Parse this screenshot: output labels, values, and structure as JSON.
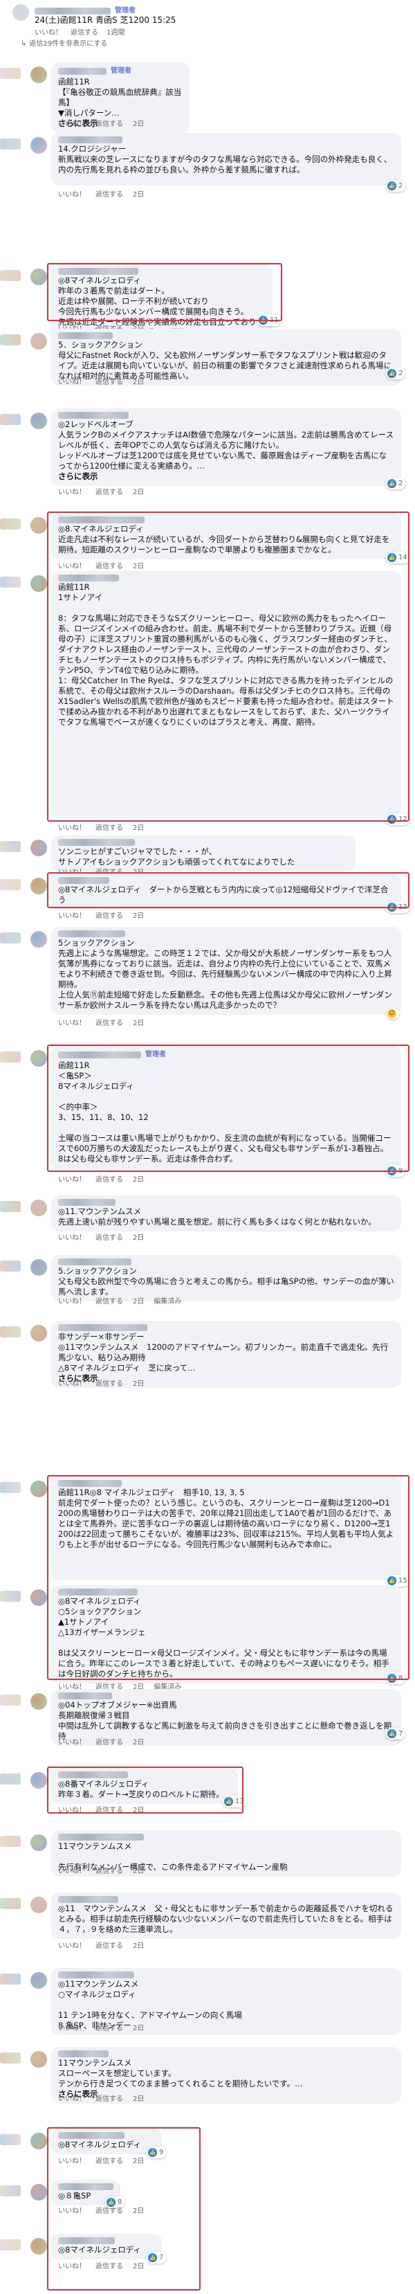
{
  "header": {
    "admin_badge": "管理者",
    "post_title": "24(土)函館11R 青函S 芝1200 15:25",
    "meta": [
      "いいね！",
      "返信する",
      "1週間"
    ],
    "hidden_replies": "返信29件を非表示にする"
  },
  "colors": {
    "highlight": "#e0313f",
    "bubble": "#f0f2f5",
    "reaction": "#0a6ee0",
    "meta": "#65676b"
  },
  "comments": [
    {
      "id": "c1",
      "admin": true,
      "text": "函館11R\n【『亀谷敬正の競馬血統辞典』該当馬】\n▼消しパターン…",
      "more": "さらに表示",
      "meta": [
        "いいね！",
        "返信する",
        "2日"
      ],
      "reaction": null
    },
    {
      "id": "c2",
      "admin": false,
      "text": "14.クロジシジャー\n新馬戦以来の芝レースになりますが今のタフな馬場なら対応できる。今回の外枠発走も良く、内の先行馬を見れる枠の並びも良い。外枠から差す競馬に徹すれば。",
      "more": "",
      "meta": [
        "いいね！",
        "返信する",
        "2日"
      ],
      "reaction": "2"
    },
    {
      "id": "c3",
      "admin": false,
      "text": "◎8マイネルジェロディ\n昨年の３着馬で前走はダート。\n近走は枠や展開、ローテ不利が続いており\n今回先行馬も少ないメンバー構成で展開も向きそう。\n先週は近走ダート経験馬や実績馬の好走も目立っており\nロベルト系も好調。巻き返しに期待。",
      "more": "",
      "meta": [
        "いいね！",
        "返信する",
        "2日"
      ],
      "reaction": "11"
    },
    {
      "id": "c4",
      "admin": false,
      "text": "5．ショックアクション\n母父にFastnet Rockが入り、父も欧州ノーザンダンサー系でタフなスプリント戦は歓迎のタイプ。近走は展開も向いていないが、前日の稍重の影響でタフさと減速耐性求められる馬場になれば相対的に素質ある可能性高い。",
      "more": "",
      "meta": [
        "いいね！",
        "返信する",
        "2日"
      ],
      "reaction": "2"
    },
    {
      "id": "c5",
      "admin": false,
      "text": "◎2レッドベルオーブ\n人気ランクBのメイクアスナッチはAI数値で危険なパターンに該当。2走前は勝馬含めてレースレベルが低く、去年OPでこの人気ならば消える方に賭けたい。\nレッドベルオーブは芝1200では底を見せていない馬で、藤原厩舎はディープ産駒を古馬になってから1200仕様に変える実績あり。…",
      "more": "さらに表示",
      "meta": [
        "いいね！",
        "返信する",
        "2日"
      ],
      "reaction": "2"
    },
    {
      "id": "c6",
      "admin": false,
      "text": "◎8.マイネルジェロディ\n近走凡走は不利なレースが続いているが、今回ダートから芝替わり&展開も向くと見て好走を期待。短距離のスクリーンヒーロー産駒なので単勝よりも複勝圏までかなと。",
      "more": "",
      "meta": [
        "いいね！",
        "返信する",
        "2日"
      ],
      "reaction": "14"
    },
    {
      "id": "c7",
      "admin": false,
      "text": "函館11R\n1サトノアイ\n\n8：タフな馬場に対応できそうなSズクリーンヒーロー、母父に欧州の馬力をもったヘイロー系、ロージズインメイの組み合わせ。前走、馬場不利でダートから芝替わりプラス。近親（母母の子）に洋芝スプリント重賞の勝利馬がいるのも心強く、グラスワンダー経由のダンチヒ、ダイナアクトレス経由のノーザンテースト、三代母のノーザンテーストの血が合わさり、ダンチヒもノーザンテーストのクロス持ちもポジティブ。内枠に先行馬がいないメンバー構成で、テンP5O、テンT4位で粘り込みに期待。\n1：母父Catcher In The Ryeは、タフな芝スプリントに対応できる馬力を持ったデインヒルの系統で、その母父は欧州ナスルーラのDarshaan。母系は父ダンチヒのクロス持ち。三代母のX1Sadler's Wellsの肌馬で欧州色が強めもスピード要素も持った組み合わせ。前走はスタートで揉め込み抜かれる不利があり出遅れてまともなレースをしておらず、また、父ハーツクライでタフな馬場でベースが速くなりにくいのはプラスと考え、再度、期待。",
      "more": "",
      "meta": [
        "いいね！",
        "返信する",
        "2日"
      ],
      "reaction": "12"
    },
    {
      "id": "c8",
      "admin": false,
      "text": "ソンニッヒがすごいジャマでした・・・が、\nサトノアイもショックアクションも頑張ってくれてなによりでした",
      "more": "",
      "meta": [
        "いいね！",
        "返信する",
        "2日"
      ],
      "reaction": null
    },
    {
      "id": "c9",
      "admin": false,
      "text": "◎8マイネルジェロディ　ダートから芝戦ともう内内に戻って◎12短縮母父ドヴァイで洋芝合う",
      "more": "",
      "meta": [
        "いいね！",
        "返信する",
        "2日"
      ],
      "reaction": "12"
    },
    {
      "id": "c10",
      "admin": false,
      "text": "5ショックアクション\n先週上にような馬場想定。この時芝１２では、父か母父が大系統ノーザンダンサー系をもつ人気薄が馬券になっておりに該当。近走は、自分より内枠の先行上位にいていることで、双馬メモより不利続きで巻き返せ到。今回は、先行経験馬少ないメンバー構成の中で内枠に入り上昇期待。\n上位人気⑪前走短縮で好走した反動懸念。その他も先週上位馬は父か母父に欧州ノーザンダンサー系か欧州ナスルーラ系を持たない馬は凡走多かったので？",
      "more": "",
      "meta": [
        "いいね！",
        "返信する",
        "2日"
      ],
      "reaction": "laugh"
    },
    {
      "id": "c11",
      "admin": true,
      "text": "函館11R\n＜亀SP＞\n8マイネルジェロディ\n\n＜的中率＞\n3、15、11、8、10、12\n\n土曜の当コースは重い馬場で上がりもかかり、反主流の血統が有利になっている。当開催コースで600万勝ちの大波乱だったレースも上がり遅く、父も母父も非サンデー系が1-3着独占。\n8は父も母父も非サンデー系。近走は条件合わず。",
      "more": "",
      "meta": [
        "いいね！",
        "返信する",
        "2日"
      ],
      "reaction": "8"
    },
    {
      "id": "c12",
      "admin": false,
      "text": "◎11.マウンテンムスメ\n先週上速い前が残りやすい馬場と風を想定。前に行く馬も多くはなく何とか粘れないか。",
      "more": "",
      "meta": [
        "いいね！",
        "返信する",
        "2日"
      ],
      "reaction": null
    },
    {
      "id": "c13",
      "admin": false,
      "text": "5.ショックアクション\n父も母父も欧州型で今の馬場に合うと考えこの馬から。相手は亀SPの他、サンデーの血が薄い馬へ流します。",
      "more": "",
      "meta": [
        "いいね！",
        "返信する",
        "2日",
        "編集済み"
      ],
      "reaction": null
    },
    {
      "id": "c14",
      "admin": false,
      "text": "非サンデー×非サンデー\n◎11マウンテンムスメ　1200のアドマイヤムーン。初ブリンカー。前走直千で逃走化。先行馬少ない、粘り込み期待\n△8マイネルジェロディ　芝に戻って…",
      "more": "さらに表示",
      "meta": [
        "いいね！",
        "返信する",
        "2日"
      ],
      "reaction": null
    },
    {
      "id": "c15",
      "admin": false,
      "text": "函館11R◎8 マイネルジェロディ　相手10, 13, 3, 5\n前走何でダート使ったの？という感じ。というのも、スクリーンヒーロー産駒は芝1200→D1200の馬場替わりローテは大の苦手で、20年以降21回出走して1A0で着が1回のるだけで、あとは全て馬券外。逆に苦手なローテの裏返しは期待値の高いローテになり易く、D1200→芝1200は22回走って勝ちこそないが、複勝率は23%、回収率は215%。平均人気着も平均人気よりも上と手が出せるローテになる。今回先行馬少ない展開利も込みで本命に。",
      "more": "",
      "meta": [
        "いいね！",
        "返信する",
        "2日"
      ],
      "reaction": "15"
    },
    {
      "id": "c16",
      "admin": false,
      "text": "◎8マイネルジェロディ\n○5ショックアクション\n▲1サトノアイ\n△13ガイザーメランジェ\n\n8は父スクリーンヒーロー×母父ロージズインメイ。父・母父ともに非サンデー系は今の馬場に合う。昨年にこのレースで３着と好走していて、その時よりもペース遅いになりそう。相手は今日好調のダンチヒ持ちから。",
      "more": "",
      "meta": [
        "いいね！",
        "返信する",
        "2日",
        "編集済み"
      ],
      "reaction": "8"
    },
    {
      "id": "c17",
      "admin": false,
      "text": "◎04トップオブメジャー※出資馬\n長期離脱復帰３戦目\n中間は乱外して調教するなど馬に刺激を与えて前向きさを引き出すことに懸命で巻き返しを期待",
      "more": "",
      "meta": [
        "いいね！",
        "返信する",
        "2日"
      ],
      "reaction": "7"
    },
    {
      "id": "c18",
      "admin": false,
      "text": "◎8番マイネルジェロディ\n昨年３着。ダート→芝戻りのロベルトに期待。",
      "more": "",
      "meta": [
        "いいね！",
        "返信する",
        "2日"
      ],
      "reaction": "13"
    },
    {
      "id": "c19",
      "admin": false,
      "text": "11マウンテンムスメ\n\n先行有利なメンバー構成で、この条件走るアドマイヤムーン産駒",
      "more": "",
      "meta": [
        "いいね！",
        "返信する",
        "2日"
      ],
      "reaction": null
    },
    {
      "id": "c20",
      "admin": false,
      "text": "◎11　マウンテンムスメ　父・母父ともに非サンデー系で前走からの距離延長でハナを切れるとみる。相手は前走先行経験のない少ないメンバーなので前走先行していた８をとる。相手は４，７，９を絡めた三連単流し。",
      "more": "",
      "meta": [
        "いいね！",
        "返信する",
        "2日"
      ],
      "reaction": null
    },
    {
      "id": "c21",
      "admin": false,
      "text": "◎11マウンテンムスメ\n○マイネルジェロディ\n\n11 テン1時を分なく、アドマイヤムーンの向く馬場\n8 亀SP、非サンデー",
      "more": "",
      "meta": [
        "いいね！",
        "返信する",
        "2日"
      ],
      "reaction": null
    },
    {
      "id": "c22",
      "admin": false,
      "text": "11マウンテンムスメ\nスローペースを想定しています。\nテンから行き足つくてのまま勝ってくれることを期待したいです。…",
      "more": "さらに表示",
      "meta": [
        "いいね！",
        "返信する",
        "2日"
      ],
      "reaction": null
    },
    {
      "id": "c23",
      "admin": false,
      "text": "◎8マイネルジェロディ",
      "more": "",
      "meta": [
        "いいね！",
        "返信する",
        "2日"
      ],
      "reaction": "9"
    },
    {
      "id": "c24",
      "admin": false,
      "text": "◎８亀SP",
      "more": "",
      "meta": [
        "いいね！",
        "返信する",
        "2日"
      ],
      "reaction": "8"
    },
    {
      "id": "c25",
      "admin": false,
      "text": "◎8マイネルジェロディ",
      "more": "",
      "meta": [
        "いいね！",
        "返信する",
        "2日"
      ],
      "reaction": "7"
    }
  ]
}
